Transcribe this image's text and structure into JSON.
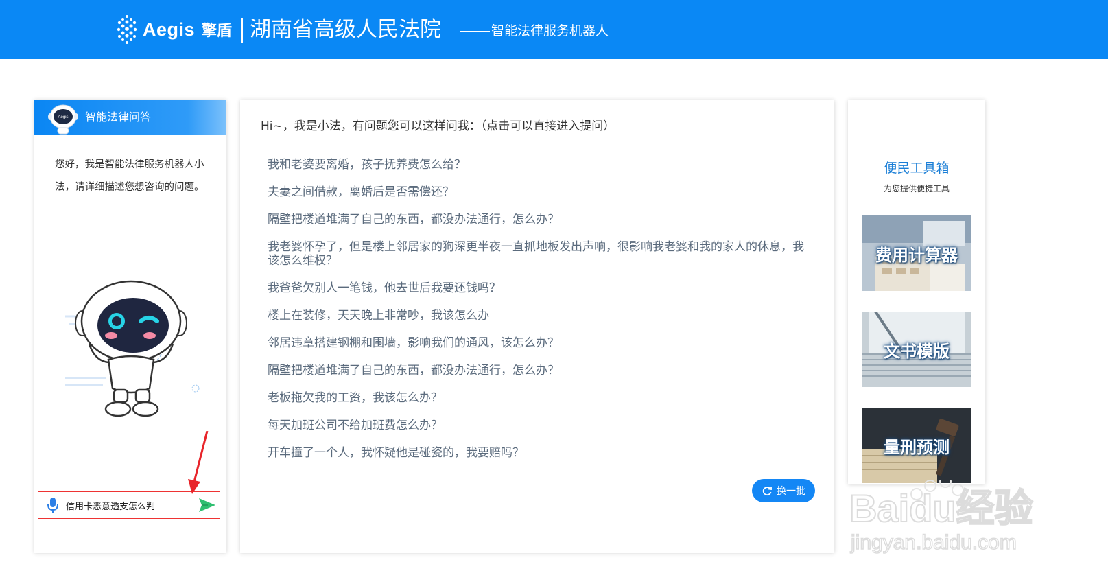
{
  "header": {
    "logo_text": "Aegis",
    "logo_cn": "擎盾",
    "title": "湖南省高级人民法院",
    "subtitle": "智能法律服务机器人"
  },
  "left": {
    "head_label": "智能法律问答",
    "avatar_label": "Aegis",
    "greeting": "您好，我是智能法律服务机器人小法，请详细描述您想咨询的问题。",
    "input_value": "信用卡恶意透支怎么判"
  },
  "middle": {
    "intro": "Hi~，我是小法，有问题您可以这样问我：（点击可以直接进入提问）",
    "questions": [
      "我和老婆要离婚，孩子抚养费怎么给？",
      "夫妻之间借款，离婚后是否需偿还？",
      "隔壁把楼道堆满了自己的东西，都没办法通行，怎么办？",
      "我老婆怀孕了，但是楼上邻居家的狗深更半夜一直抓地板发出声响，很影响我老婆和我的家人的休息，我该怎么维权？",
      "我爸爸欠别人一笔钱，他去世后我要还钱吗？",
      "楼上在装修，天天晚上非常吵，我该怎么办",
      "邻居违章搭建钢棚和围墙，影响我们的通风，该怎么办？",
      "隔壁把楼道堆满了自己的东西，都没办法通行，怎么办？",
      "老板拖欠我的工资，我该怎么办？",
      "每天加班公司不给加班费怎么办？",
      "开车撞了一个人，我怀疑他是碰瓷的，我要赔吗？"
    ],
    "refresh_label": "换一批"
  },
  "right": {
    "title": "便民工具箱",
    "subtitle": "为您提供便捷工具",
    "tools": [
      "费用计算器",
      "文书模版",
      "量刑预测"
    ]
  },
  "watermark": {
    "brand": "Baidu经验",
    "url": "jingyan.baidu.com"
  },
  "colors": {
    "header_bg": "#0a88f5",
    "accent": "#1487f5",
    "question_text": "#5b6b7d",
    "highlight_border": "#e33333",
    "send_green": "#2fbf71"
  }
}
